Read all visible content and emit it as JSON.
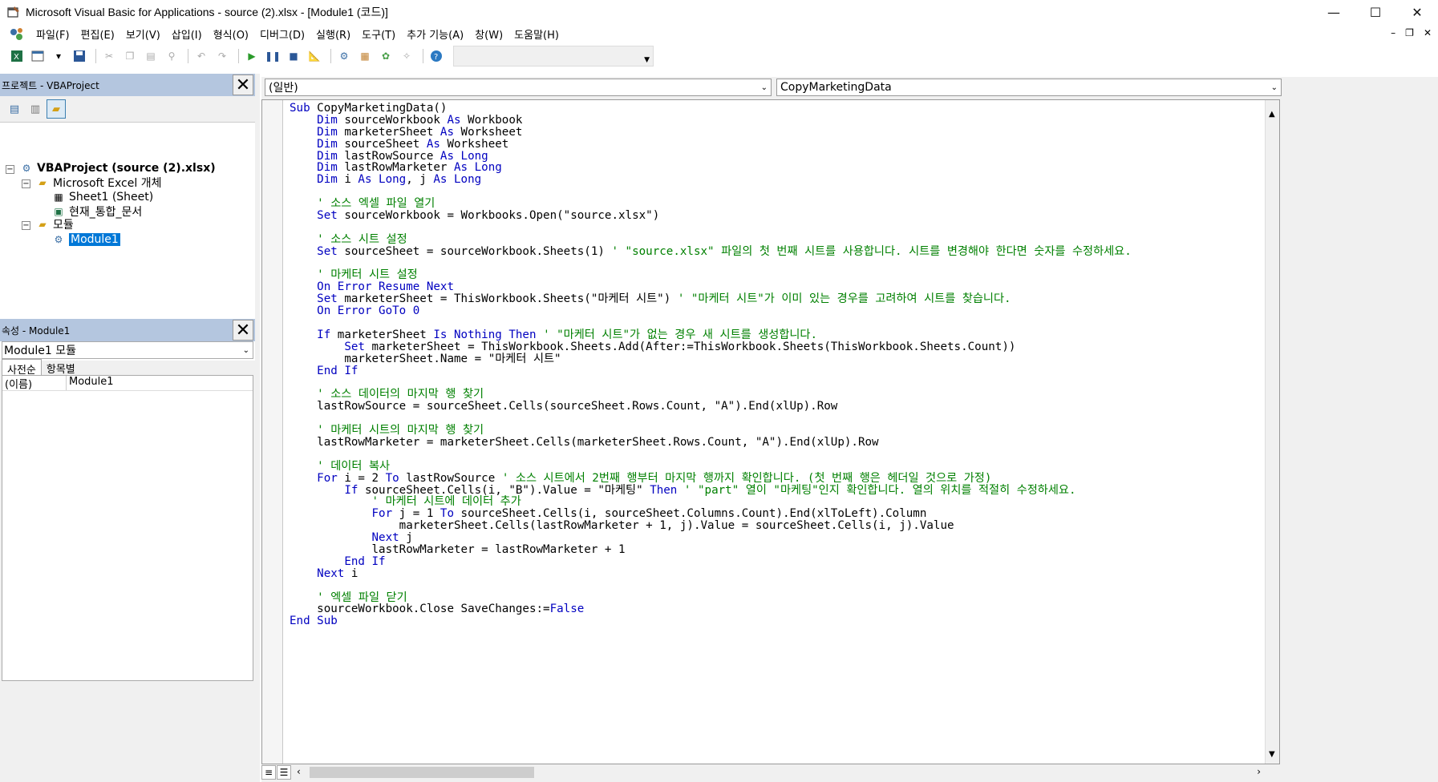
{
  "window": {
    "title": "Microsoft Visual Basic for Applications - source (2).xlsx - [Module1 (코드)]",
    "controls": [
      "—",
      "☐",
      "✕"
    ]
  },
  "menu": {
    "items": [
      "파일(F)",
      "편집(E)",
      "보기(V)",
      "삽입(I)",
      "형식(O)",
      "디버그(D)",
      "실행(R)",
      "도구(T)",
      "추가 기능(A)",
      "창(W)",
      "도움말(H)"
    ],
    "mdi_controls": [
      "–",
      "❐",
      "✕"
    ]
  },
  "project_pane": {
    "title": "프로젝트 - VBAProject",
    "tree": {
      "root": "VBAProject (source (2).xlsx)",
      "folder_objects": "Microsoft Excel 개체",
      "sheet1": "Sheet1 (Sheet)",
      "workbook": "현재_통합_문서",
      "folder_modules": "모듈",
      "module1": "Module1"
    }
  },
  "properties_pane": {
    "title": "속성 - Module1",
    "object_select": "Module1 모듈",
    "tabs": [
      "사전순",
      "항목별"
    ],
    "rows": [
      {
        "key": "(이름)",
        "value": "Module1"
      }
    ]
  },
  "code_pane": {
    "object_combo": "(일반)",
    "procedure_combo": "CopyMarketingData",
    "lines": [
      [
        {
          "t": "Sub",
          "k": "kw"
        },
        {
          "t": " CopyMarketingData()"
        }
      ],
      [
        {
          "t": "    "
        },
        {
          "t": "Dim",
          "k": "kw"
        },
        {
          "t": " sourceWorkbook "
        },
        {
          "t": "As",
          "k": "kw"
        },
        {
          "t": " Workbook"
        }
      ],
      [
        {
          "t": "    "
        },
        {
          "t": "Dim",
          "k": "kw"
        },
        {
          "t": " marketerSheet "
        },
        {
          "t": "As",
          "k": "kw"
        },
        {
          "t": " Worksheet"
        }
      ],
      [
        {
          "t": "    "
        },
        {
          "t": "Dim",
          "k": "kw"
        },
        {
          "t": " sourceSheet "
        },
        {
          "t": "As",
          "k": "kw"
        },
        {
          "t": " Worksheet"
        }
      ],
      [
        {
          "t": "    "
        },
        {
          "t": "Dim",
          "k": "kw"
        },
        {
          "t": " lastRowSource "
        },
        {
          "t": "As Long",
          "k": "kw"
        }
      ],
      [
        {
          "t": "    "
        },
        {
          "t": "Dim",
          "k": "kw"
        },
        {
          "t": " lastRowMarketer "
        },
        {
          "t": "As Long",
          "k": "kw"
        }
      ],
      [
        {
          "t": "    "
        },
        {
          "t": "Dim",
          "k": "kw"
        },
        {
          "t": " i "
        },
        {
          "t": "As Long",
          "k": "kw"
        },
        {
          "t": ", j "
        },
        {
          "t": "As Long",
          "k": "kw"
        }
      ],
      [
        {
          "t": ""
        }
      ],
      [
        {
          "t": "    "
        },
        {
          "t": "' 소스 엑셀 파일 열기",
          "k": "cm"
        }
      ],
      [
        {
          "t": "    "
        },
        {
          "t": "Set",
          "k": "kw"
        },
        {
          "t": " sourceWorkbook = Workbooks.Open(\"source.xlsx\")"
        }
      ],
      [
        {
          "t": ""
        }
      ],
      [
        {
          "t": "    "
        },
        {
          "t": "' 소스 시트 설정",
          "k": "cm"
        }
      ],
      [
        {
          "t": "    "
        },
        {
          "t": "Set",
          "k": "kw"
        },
        {
          "t": " sourceSheet = sourceWorkbook.Sheets(1) "
        },
        {
          "t": "' \"source.xlsx\" 파일의 첫 번째 시트를 사용합니다. 시트를 변경해야 한다면 숫자를 수정하세요.",
          "k": "cm"
        }
      ],
      [
        {
          "t": ""
        }
      ],
      [
        {
          "t": "    "
        },
        {
          "t": "' 마케터 시트 설정",
          "k": "cm"
        }
      ],
      [
        {
          "t": "    "
        },
        {
          "t": "On Error Resume Next",
          "k": "kw"
        }
      ],
      [
        {
          "t": "    "
        },
        {
          "t": "Set",
          "k": "kw"
        },
        {
          "t": " marketerSheet = ThisWorkbook.Sheets(\"마케터 시트\") "
        },
        {
          "t": "' \"마케터 시트\"가 이미 있는 경우를 고려하여 시트를 찾습니다.",
          "k": "cm"
        }
      ],
      [
        {
          "t": "    "
        },
        {
          "t": "On Error GoTo 0",
          "k": "kw"
        }
      ],
      [
        {
          "t": ""
        }
      ],
      [
        {
          "t": "    "
        },
        {
          "t": "If",
          "k": "kw"
        },
        {
          "t": " marketerSheet "
        },
        {
          "t": "Is Nothing Then",
          "k": "kw"
        },
        {
          "t": " "
        },
        {
          "t": "' \"마케터 시트\"가 없는 경우 새 시트를 생성합니다.",
          "k": "cm"
        }
      ],
      [
        {
          "t": "        "
        },
        {
          "t": "Set",
          "k": "kw"
        },
        {
          "t": " marketerSheet = ThisWorkbook.Sheets.Add(After:=ThisWorkbook.Sheets(ThisWorkbook.Sheets.Count))"
        }
      ],
      [
        {
          "t": "        marketerSheet.Name = \"마케터 시트\""
        }
      ],
      [
        {
          "t": "    "
        },
        {
          "t": "End If",
          "k": "kw"
        }
      ],
      [
        {
          "t": ""
        }
      ],
      [
        {
          "t": "    "
        },
        {
          "t": "' 소스 데이터의 마지막 행 찾기",
          "k": "cm"
        }
      ],
      [
        {
          "t": "    lastRowSource = sourceSheet.Cells(sourceSheet.Rows.Count, \"A\").End(xlUp).Row"
        }
      ],
      [
        {
          "t": ""
        }
      ],
      [
        {
          "t": "    "
        },
        {
          "t": "' 마케터 시트의 마지막 행 찾기",
          "k": "cm"
        }
      ],
      [
        {
          "t": "    lastRowMarketer = marketerSheet.Cells(marketerSheet.Rows.Count, \"A\").End(xlUp).Row"
        }
      ],
      [
        {
          "t": ""
        }
      ],
      [
        {
          "t": "    "
        },
        {
          "t": "' 데이터 복사",
          "k": "cm"
        }
      ],
      [
        {
          "t": "    "
        },
        {
          "t": "For",
          "k": "kw"
        },
        {
          "t": " i = 2 "
        },
        {
          "t": "To",
          "k": "kw"
        },
        {
          "t": " lastRowSource "
        },
        {
          "t": "' 소스 시트에서 2번째 행부터 마지막 행까지 확인합니다. (첫 번째 행은 헤더일 것으로 가정)",
          "k": "cm"
        }
      ],
      [
        {
          "t": "        "
        },
        {
          "t": "If",
          "k": "kw"
        },
        {
          "t": " sourceSheet.Cells(i, \"B\").Value = \"마케팅\" "
        },
        {
          "t": "Then",
          "k": "kw"
        },
        {
          "t": " "
        },
        {
          "t": "' \"part\" 열이 \"마케팅\"인지 확인합니다. 열의 위치를 적절히 수정하세요.",
          "k": "cm"
        }
      ],
      [
        {
          "t": "            "
        },
        {
          "t": "' 마케터 시트에 데이터 추가",
          "k": "cm"
        }
      ],
      [
        {
          "t": "            "
        },
        {
          "t": "For",
          "k": "kw"
        },
        {
          "t": " j = 1 "
        },
        {
          "t": "To",
          "k": "kw"
        },
        {
          "t": " sourceSheet.Cells(i, sourceSheet.Columns.Count).End(xlToLeft).Column"
        }
      ],
      [
        {
          "t": "                marketerSheet.Cells(lastRowMarketer + 1, j).Value = sourceSheet.Cells(i, j).Value"
        }
      ],
      [
        {
          "t": "            "
        },
        {
          "t": "Next",
          "k": "kw"
        },
        {
          "t": " j"
        }
      ],
      [
        {
          "t": "            lastRowMarketer = lastRowMarketer + 1"
        }
      ],
      [
        {
          "t": "        "
        },
        {
          "t": "End If",
          "k": "kw"
        }
      ],
      [
        {
          "t": "    "
        },
        {
          "t": "Next",
          "k": "kw"
        },
        {
          "t": " i"
        }
      ],
      [
        {
          "t": ""
        }
      ],
      [
        {
          "t": "    "
        },
        {
          "t": "' 엑셀 파일 닫기",
          "k": "cm"
        }
      ],
      [
        {
          "t": "    sourceWorkbook.Close SaveChanges:="
        },
        {
          "t": "False",
          "k": "kw"
        }
      ],
      [
        {
          "t": "End Sub",
          "k": "kw"
        }
      ]
    ]
  },
  "colors": {
    "keyword": "#0000c0",
    "comment": "#008000",
    "pane_header": "#b4c6df",
    "selection": "#0078d7"
  },
  "icons": [
    "vba-app-icon",
    "excel-icon",
    "insert-userform-icon",
    "save-icon",
    "cut-icon",
    "copy-icon",
    "paste-icon",
    "find-icon",
    "undo-icon",
    "redo-icon",
    "run-icon",
    "break-icon",
    "reset-icon",
    "design-mode-icon",
    "project-explorer-icon",
    "properties-window-icon",
    "object-browser-icon",
    "toolbox-icon",
    "help-icon"
  ]
}
